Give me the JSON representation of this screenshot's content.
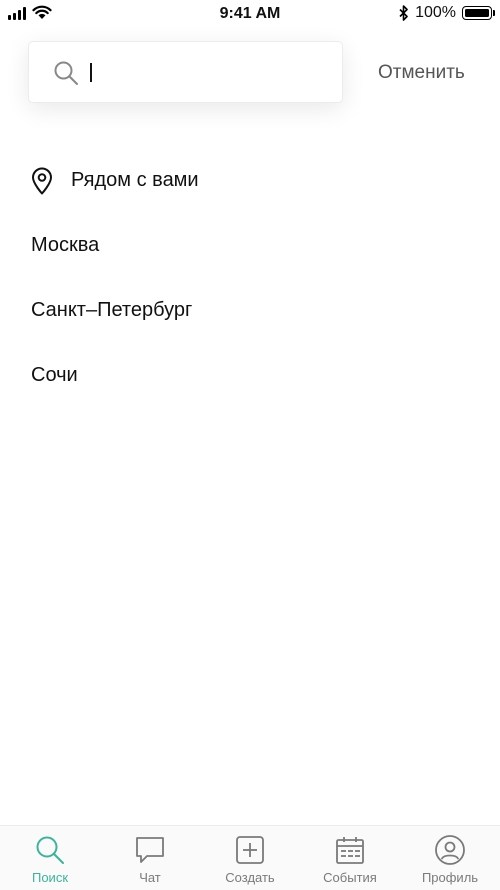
{
  "status_bar": {
    "time": "9:41 AM",
    "battery_percent_label": "100%",
    "battery_level": 1.0,
    "icons": [
      "signal-icon",
      "wifi-icon",
      "bluetooth-icon",
      "battery-icon"
    ]
  },
  "search": {
    "value": "",
    "placeholder": "",
    "cancel_label": "Отменить"
  },
  "results": [
    {
      "label": "Рядом с вами",
      "icon": "location-pin-icon"
    },
    {
      "label": "Москва"
    },
    {
      "label": "Санкт–Петербург"
    },
    {
      "label": "Сочи"
    }
  ],
  "tab_bar": {
    "tabs": [
      {
        "label": "Поиск",
        "icon": "search-icon",
        "active": true
      },
      {
        "label": "Чат",
        "icon": "chat-icon",
        "active": false
      },
      {
        "label": "Создать",
        "icon": "add-square-icon",
        "active": false
      },
      {
        "label": "События",
        "icon": "calendar-icon",
        "active": false
      },
      {
        "label": "Профиль",
        "icon": "profile-icon",
        "active": false
      }
    ]
  },
  "colors": {
    "accent": "#39b59a",
    "inactive": "#7a7a7a",
    "text": "#111111"
  }
}
